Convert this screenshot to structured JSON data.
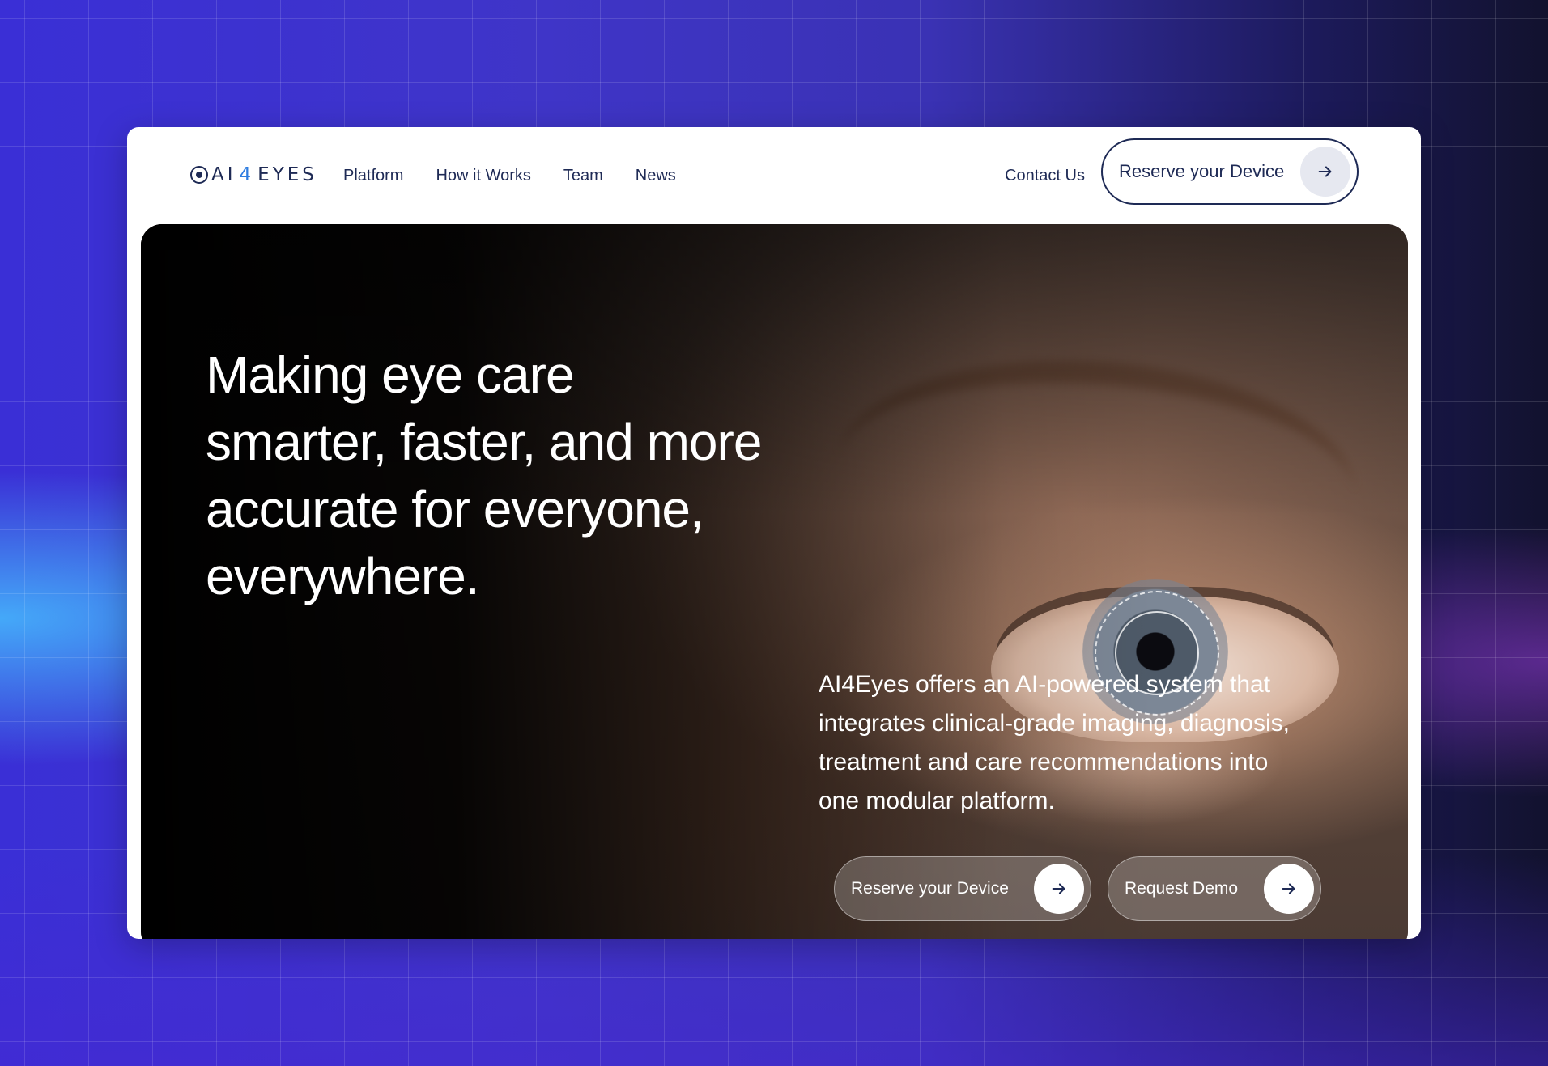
{
  "brand": {
    "logo_prefix": "AI",
    "logo_digit": "4",
    "logo_suffix": "EYES",
    "accent_color": "#2f7de0",
    "ink_color": "#1e2a55"
  },
  "nav": {
    "links": [
      "Platform",
      "How it Works",
      "Team",
      "News"
    ],
    "contact_label": "Contact Us",
    "reserve_label": "Reserve your Device"
  },
  "hero": {
    "title_lines": [
      "Making eye care",
      "smarter, faster, and more",
      "accurate for everyone,",
      "everywhere."
    ],
    "body_lines": [
      "AI4Eyes offers an AI-powered system that",
      "integrates clinical-grade imaging, diagnosis,",
      "treatment and care recommendations into",
      "one modular platform."
    ],
    "cta_reserve": "Reserve your Device",
    "cta_demo": "Request Demo"
  },
  "icons": {
    "arrow": "arrow-right-icon",
    "logo": "eye-logo-icon"
  }
}
